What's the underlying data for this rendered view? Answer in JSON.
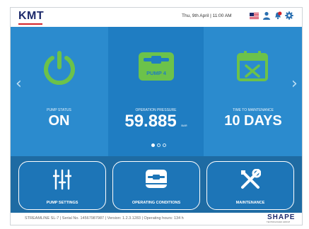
{
  "header": {
    "logo": "KMT",
    "datetime": "Thu, 9th April  |  11:00 AM",
    "icons": [
      "us-flag-icon",
      "user-icon",
      "alert-icon",
      "gear-icon"
    ],
    "colors": {
      "logo": "#1d2a6b",
      "logo_underline": "#d2232a",
      "alert": "#d2232a"
    }
  },
  "carousel": {
    "panels": [
      {
        "label": "PUMP STATUS",
        "value": "ON",
        "icon": "power-icon"
      },
      {
        "label": "OPERATION PRESSURE",
        "value": "59.885",
        "unit": "BAR",
        "icon": "pump-icon",
        "icon_text": "PUMP 4"
      },
      {
        "label": "TIME TO MAINTENANCE",
        "value": "10 DAYS",
        "icon": "calendar-wrench-icon"
      }
    ],
    "active_page": 1,
    "page_count": 3,
    "accent": "#6cc24a"
  },
  "tiles": [
    {
      "label": "PUMP SETTINGS",
      "icon": "sliders-icon"
    },
    {
      "label": "OPERATING CONDITIONS",
      "icon": "pump-monitor-icon"
    },
    {
      "label": "MAINTENANCE",
      "icon": "tools-icon"
    }
  ],
  "footer": {
    "text": "STREAMLINE SL-7   |   Serial No. 14567987987   |   Version: 1.2.3.1283   |   Operating hours: 134 h",
    "brand": "SHAPE",
    "brand_sub": "TECHNOLOGIES GROUP"
  }
}
